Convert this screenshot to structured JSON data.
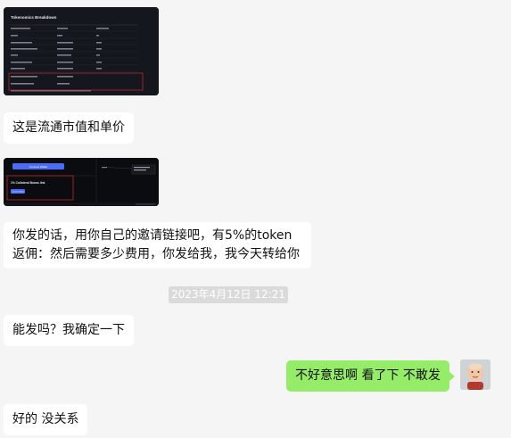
{
  "messages": {
    "m1": "这是流通市值和单价",
    "m2": "你发的话，用你自己的邀请链接吧，有5%的token返佣：然后需要多少费用，你发给我，我今天转给你",
    "m3": "能发吗？我确定一下",
    "m4": "不好意思啊 看了下 不敢发",
    "m5": "好的 没关系"
  },
  "timestamp": "2023年4月12日 12:21",
  "image1": {
    "title": "Tokenomics Breakdown"
  },
  "image2": {
    "button1": "Connect Wallet",
    "heading": "1% Collateral Bonus link",
    "button2": "Connect Wallet"
  },
  "colors": {
    "chat_bg": "#f5f5f5",
    "own_bubble": "#95ec69",
    "other_bubble": "#ffffff",
    "highlight_red": "#c0262d",
    "button_blue": "#4a6cf7"
  }
}
